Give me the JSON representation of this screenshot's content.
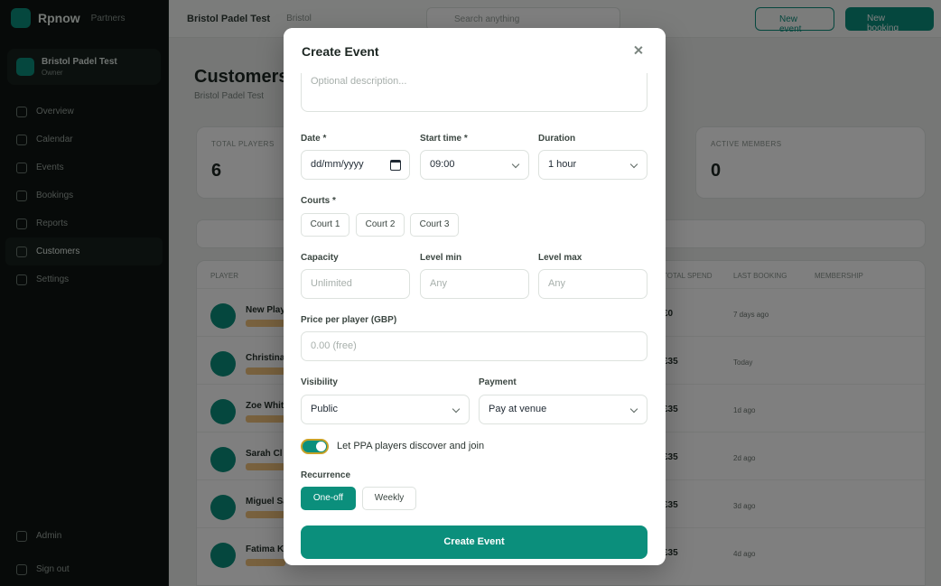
{
  "background": {
    "brand": {
      "name": "Rpnow",
      "tag": "Partners"
    },
    "club": {
      "name": "Bristol Padel Test",
      "role": "Owner"
    },
    "nav": [
      {
        "label": "Overview"
      },
      {
        "label": "Calendar"
      },
      {
        "label": "Events"
      },
      {
        "label": "Bookings"
      },
      {
        "label": "Reports"
      },
      {
        "label": "Customers"
      },
      {
        "label": "Settings"
      }
    ],
    "nav_bottom": [
      {
        "label": "Admin"
      },
      {
        "label": "Sign out"
      }
    ],
    "topbar": {
      "title": "Bristol Padel Test",
      "chip": "Bristol",
      "search_placeholder": "Search anything",
      "btn_outline": "New event",
      "btn_fill": "New booking"
    },
    "page": {
      "title": "Customers",
      "subtitle": "Bristol Padel Test"
    },
    "stats": [
      {
        "label": "TOTAL PLAYERS",
        "value": "6"
      },
      {
        "label": "ACTIVE MEMBERS",
        "value": "0"
      }
    ],
    "table": {
      "headers": [
        "PLAYER",
        "TOTAL SPEND",
        "LAST BOOKING",
        "MEMBERSHIP"
      ],
      "rows": [
        {
          "name": "New Play",
          "spend": "£0",
          "last": "7 days ago"
        },
        {
          "name": "Christina",
          "spend": "£35",
          "last": "Today"
        },
        {
          "name": "Zoe White",
          "spend": "£35",
          "last": "1d ago"
        },
        {
          "name": "Sarah Cl",
          "spend": "£35",
          "last": "2d ago"
        },
        {
          "name": "Miguel Sa",
          "spend": "£35",
          "last": "3d ago"
        },
        {
          "name": "Fatima K",
          "spend": "£35",
          "last": "4d ago"
        }
      ]
    }
  },
  "modal": {
    "title": "Create Event",
    "description_placeholder": "Optional description...",
    "date": {
      "label": "Date *",
      "value": "dd/mm/yyyy"
    },
    "start_time": {
      "label": "Start time *",
      "value": "09:00"
    },
    "duration": {
      "label": "Duration",
      "value": "1 hour"
    },
    "courts": {
      "label": "Courts *",
      "options": [
        "Court 1",
        "Court 2",
        "Court 3"
      ]
    },
    "capacity": {
      "label": "Capacity",
      "placeholder": "Unlimited"
    },
    "level_min": {
      "label": "Level min",
      "placeholder": "Any"
    },
    "level_max": {
      "label": "Level max",
      "placeholder": "Any"
    },
    "price": {
      "label": "Price per player (GBP)",
      "placeholder": "0.00 (free)"
    },
    "visibility": {
      "label": "Visibility",
      "value": "Public"
    },
    "payment": {
      "label": "Payment",
      "value": "Pay at venue"
    },
    "ppa_toggle": {
      "label": "Let PPA players discover and join",
      "on": true
    },
    "recurrence": {
      "label": "Recurrence",
      "options": [
        "One-off",
        "Weekly"
      ],
      "selected": "One-off"
    },
    "submit_label": "Create Event"
  },
  "colors": {
    "accent": "#0b8f7c",
    "overlay": "rgba(0,0,0,0.5)"
  }
}
